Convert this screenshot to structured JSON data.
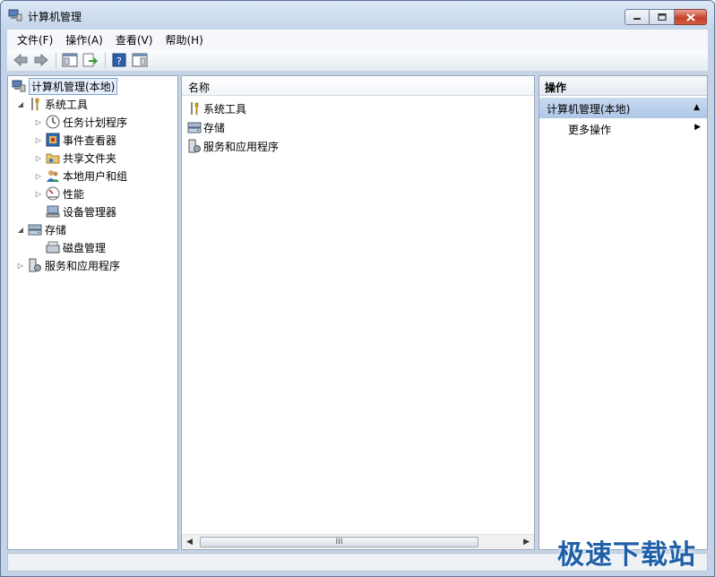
{
  "window": {
    "title": "计算机管理"
  },
  "menu": [
    "文件(F)",
    "操作(A)",
    "查看(V)",
    "帮助(H)"
  ],
  "toolbar": {
    "buttons": [
      "back-icon",
      "forward-icon",
      "show-hide-tree-icon",
      "export-icon",
      "help-icon",
      "show-hide-action-pane-icon"
    ]
  },
  "tree": {
    "root": "计算机管理(本地)",
    "system_tools": "系统工具",
    "task_scheduler": "任务计划程序",
    "event_viewer": "事件查看器",
    "shared_folders": "共享文件夹",
    "local_users": "本地用户和组",
    "performance": "性能",
    "device_manager": "设备管理器",
    "storage": "存储",
    "disk_management": "磁盘管理",
    "services_apps": "服务和应用程序"
  },
  "list": {
    "column_name": "名称",
    "items": [
      "系统工具",
      "存储",
      "服务和应用程序"
    ],
    "scroll_grip": "III"
  },
  "actions": {
    "header": "操作",
    "group": "计算机管理(本地)",
    "more": "更多操作"
  },
  "watermark": "极速下载站",
  "colors": {
    "accent": "#1f5fa8",
    "selection": "#aec6e6"
  }
}
